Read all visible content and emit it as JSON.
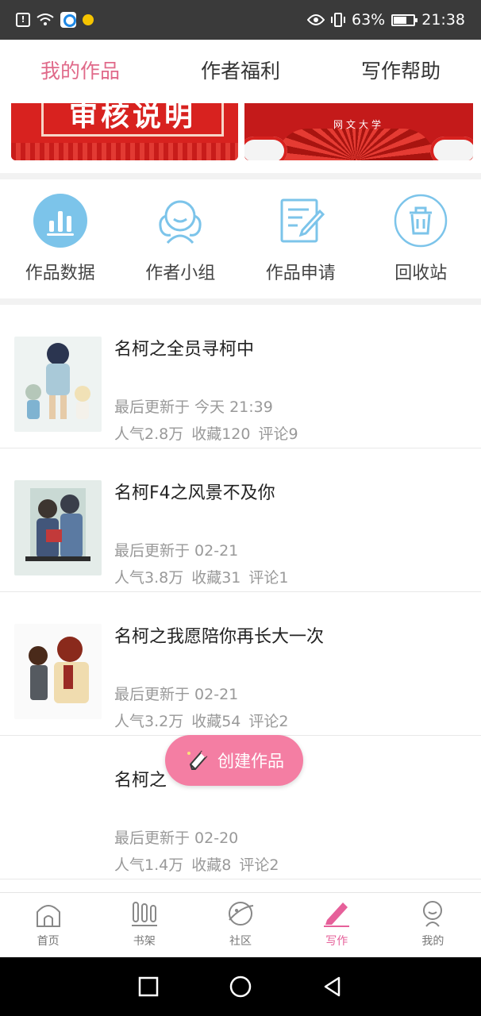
{
  "status_bar": {
    "battery": "63%",
    "time": "21:38"
  },
  "tabs": [
    {
      "label": "我的作品"
    },
    {
      "label": "作者福利"
    },
    {
      "label": "写作帮助"
    }
  ],
  "banners": [
    {
      "text": "审核说明"
    },
    {
      "text": "网文大学"
    }
  ],
  "quick_actions": [
    {
      "label": "作品数据",
      "icon": "chart-icon"
    },
    {
      "label": "作者小组",
      "icon": "group-icon"
    },
    {
      "label": "作品申请",
      "icon": "edit-form-icon"
    },
    {
      "label": "回收站",
      "icon": "trash-icon"
    }
  ],
  "works": [
    {
      "title": "名柯之全员寻柯中",
      "updated": "最后更新于 今天 21:39",
      "popularity": "人气2.8万",
      "favorites": "收藏120",
      "comments": "评论9"
    },
    {
      "title": "名柯F4之风景不及你",
      "updated": "最后更新于 02-21",
      "popularity": "人气3.8万",
      "favorites": "收藏31",
      "comments": "评论1"
    },
    {
      "title": "名柯之我愿陪你再长大一次",
      "updated": "最后更新于 02-21",
      "popularity": "人气3.2万",
      "favorites": "收藏54",
      "comments": "评论2"
    },
    {
      "title": "名柯之",
      "updated": "最后更新于 02-20",
      "popularity": "人气1.4万",
      "favorites": "收藏8",
      "comments": "评论2"
    }
  ],
  "fab": {
    "label": "创建作品"
  },
  "bottom_nav": [
    {
      "label": "首页",
      "icon": "home-icon"
    },
    {
      "label": "书架",
      "icon": "bookshelf-icon"
    },
    {
      "label": "社区",
      "icon": "planet-icon"
    },
    {
      "label": "写作",
      "icon": "pen-icon",
      "active": true
    },
    {
      "label": "我的",
      "icon": "profile-icon"
    }
  ],
  "colors": {
    "accent": "#e06a8a",
    "fab": "#f47ea3",
    "icon_blue": "#7cc4ea"
  }
}
